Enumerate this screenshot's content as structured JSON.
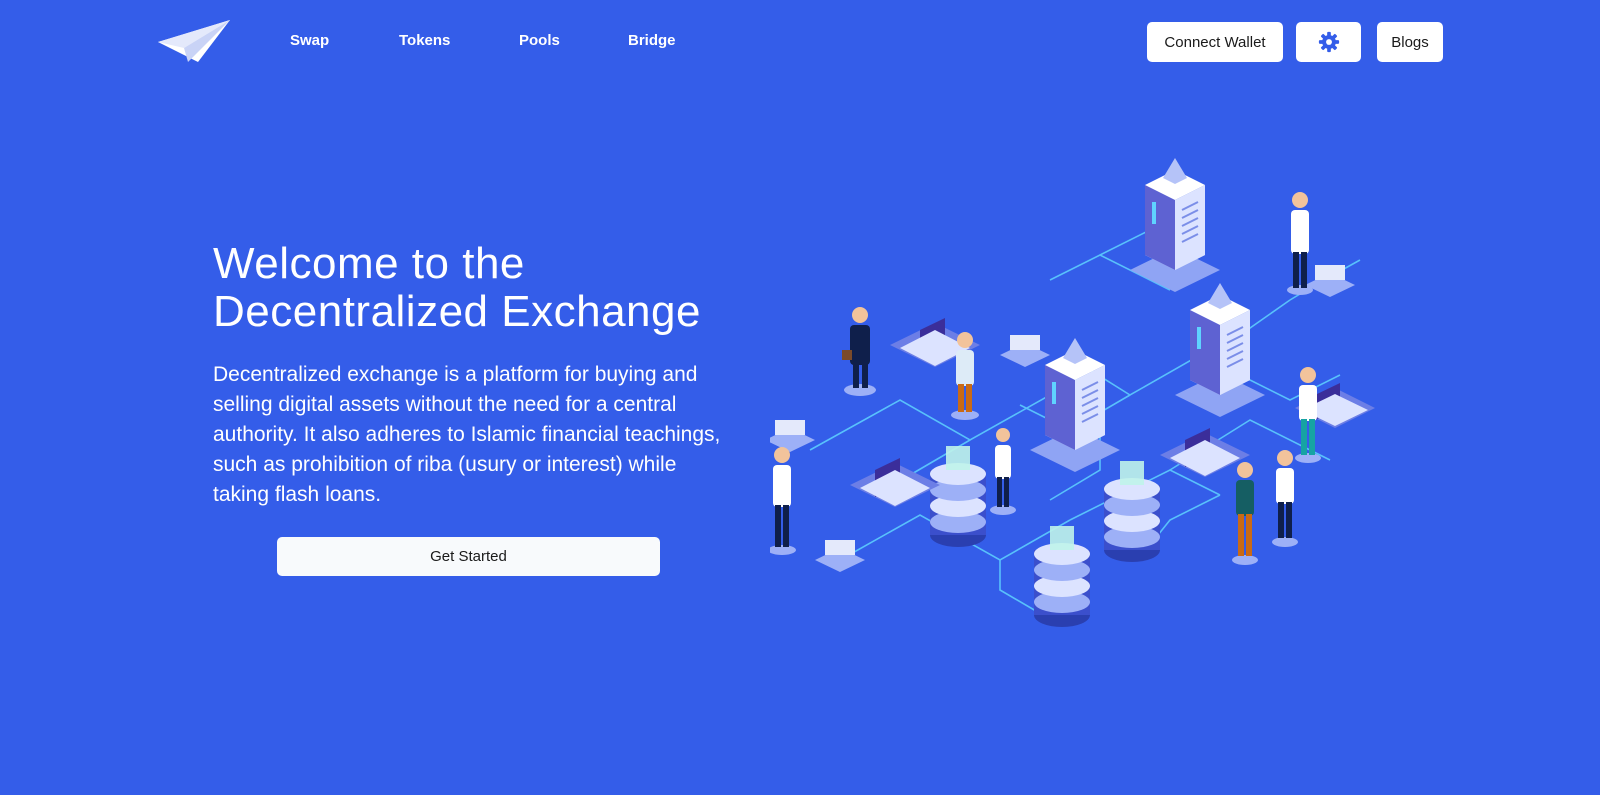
{
  "nav": {
    "links": [
      "Swap",
      "Tokens",
      "Pools",
      "Bridge"
    ],
    "connect_wallet": "Connect Wallet",
    "blogs": "Blogs"
  },
  "hero": {
    "title_line1": "Welcome to the",
    "title_line2": "Decentralized Exchange",
    "description": "Decentralized exchange is a platform for buying and selling digital assets without the need for a central authority. It also adheres to Islamic financial teachings, such as prohibition of riba (usury or interest) while taking flash loans.",
    "cta": "Get Started"
  },
  "colors": {
    "background": "#345DE9",
    "button_bg": "#FFFFFF",
    "circuit": "#5FD3FF"
  },
  "icons": {
    "logo": "paper-plane-icon",
    "settings": "gear-icon"
  }
}
